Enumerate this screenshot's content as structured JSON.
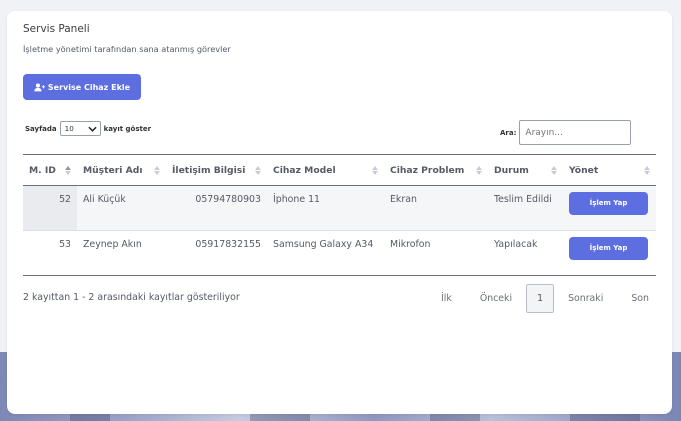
{
  "panel": {
    "title": "Servis Paneli",
    "subtitle": "İşletme yönetimi tarafından sana atanmış görevler",
    "add_button": "Servise Cihaz Ekle",
    "add_icon": "user-plus-icon"
  },
  "table_controls": {
    "length_prefix": "Sayfada",
    "length_value": "10",
    "length_suffix": "kayıt göster",
    "search_label": "Ara:",
    "search_placeholder": "Arayın..."
  },
  "table": {
    "columns": [
      "M. ID",
      "Müşteri Adı",
      "İletişim Bilgisi",
      "Cihaz Model",
      "Cihaz Problem",
      "Durum",
      "Yönet"
    ],
    "rows": [
      {
        "id": "52",
        "customer": "Ali Küçük",
        "contact": "05794780903",
        "model": "İphone 11",
        "problem": "Ekran",
        "status": "Teslim Edildi",
        "action": "İşlem Yap"
      },
      {
        "id": "53",
        "customer": "Zeynep Akın",
        "contact": "05917832155",
        "model": "Samsung Galaxy A34",
        "problem": "Mikrofon",
        "status": "Yapılacak",
        "action": "İşlem Yap"
      }
    ]
  },
  "footer": {
    "info": "2 kayıttan 1 - 2 arasındaki kayıtlar gösteriliyor",
    "pagination": {
      "first": "İlk",
      "prev": "Önceki",
      "current": "1",
      "next": "Sonraki",
      "last": "Son"
    }
  },
  "colors": {
    "accent": "#5d6fe0",
    "background": "#f1f2f5"
  }
}
